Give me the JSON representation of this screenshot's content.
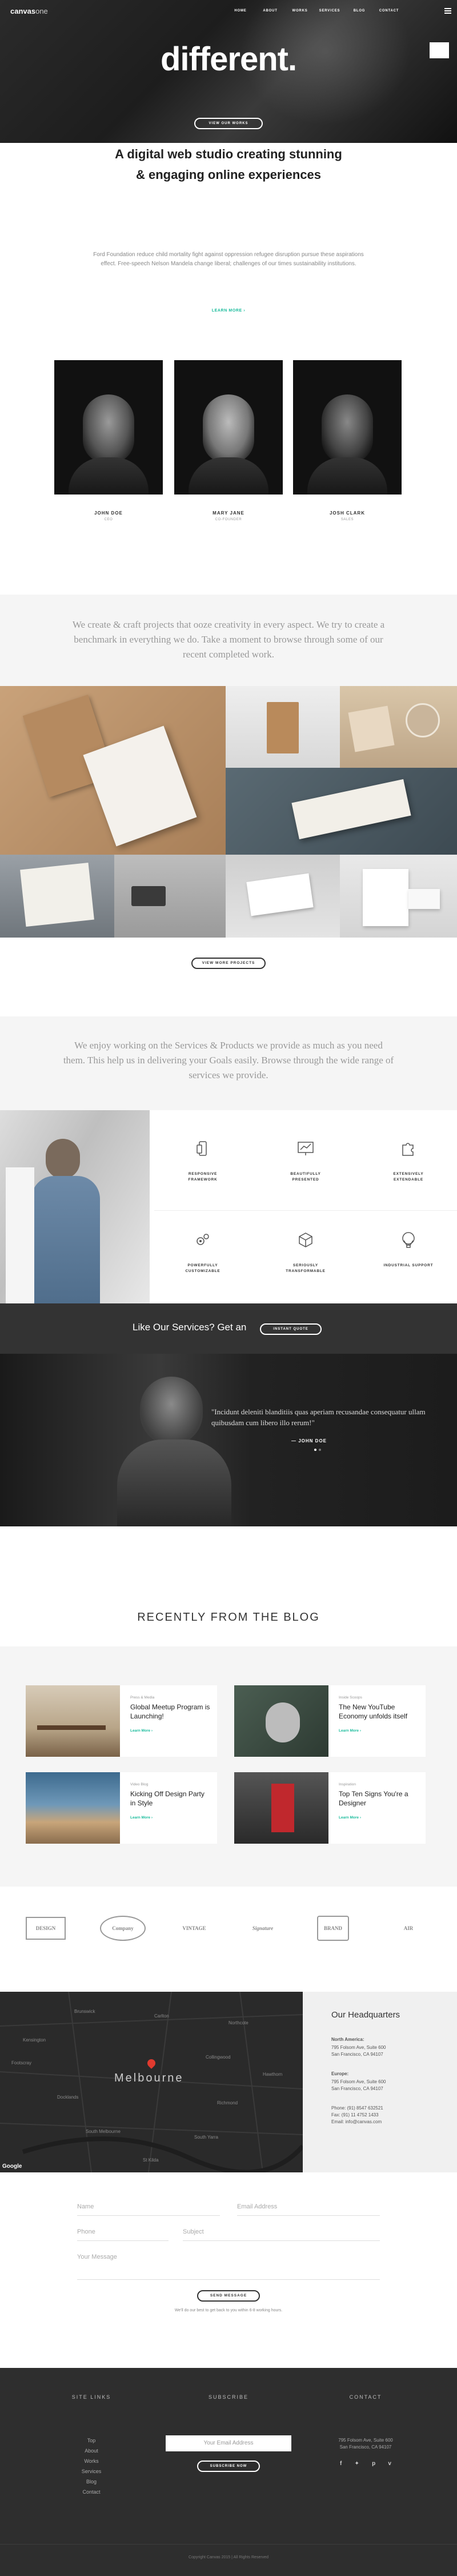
{
  "header": {
    "logo_main": "canvas",
    "logo_accent": "one",
    "nav": [
      "HOME",
      "ABOUT",
      "WORKS",
      "SERVICES",
      "BLOG",
      "CONTACT"
    ],
    "hero_title": "different.",
    "hero_button": "VIEW OUR WORKS"
  },
  "intro": {
    "heading_line1": "A digital web studio creating stunning",
    "heading_line2": "& engaging online experiences",
    "paragraph": "Ford Foundation reduce child mortality fight against oppression refugee disruption pursue these aspirations effect. Free-speech Nelson Mandela change liberal; challenges of our times sustainability institutions.",
    "link": "LEARN MORE ›"
  },
  "team": [
    {
      "name": "JOHN DOE",
      "role": "CEO"
    },
    {
      "name": "MARY JANE",
      "role": "CO-FOUNDER"
    },
    {
      "name": "JOSH CLARK",
      "role": "SALES"
    }
  ],
  "works": {
    "intro": "We create & craft projects that ooze creativity in every aspect. We try to create a benchmark in everything we do. Take a moment to browse through some of our recent completed work.",
    "button": "VIEW MORE PROJECTS"
  },
  "services": {
    "intro": "We enjoy working on the Services & Products we provide as much as you need them. This help us in delivering your Goals easily. Browse through the wide range of services we provide.",
    "items": [
      {
        "label_1": "RESPONSIVE",
        "label_2": "FRAMEWORK",
        "icon": "mobile-icon"
      },
      {
        "label_1": "BEAUTIFULLY",
        "label_2": "PRESENTED",
        "icon": "chart-monitor-icon"
      },
      {
        "label_1": "EXTENSIVELY",
        "label_2": "EXTENDABLE",
        "icon": "puzzle-icon"
      },
      {
        "label_1": "POWERFULLY",
        "label_2": "CUSTOMIZABLE",
        "icon": "gears-icon"
      },
      {
        "label_1": "SERIOUSLY",
        "label_2": "TRANSFORMABLE",
        "icon": "cube-icon"
      },
      {
        "label_1": "INDUSTRIAL SUPPORT",
        "label_2": "",
        "icon": "balloon-icon"
      }
    ]
  },
  "cta": {
    "text": "Like Our Services? Get an",
    "button": "INSTANT QUOTE"
  },
  "testimonial": {
    "quote": "\"Incidunt deleniti blanditiis quas aperiam recusandae consequatur ullam quibusdam cum libero illo rerum!\"",
    "author": "— JOHN DOE"
  },
  "blog": {
    "heading": "RECENTLY FROM THE BLOG",
    "posts": [
      {
        "category": "Press & Media",
        "title": "Global Meetup Program is Launching!",
        "more": "Learn More ›"
      },
      {
        "category": "Inside Scoops",
        "title": "The New YouTube Economy unfolds itself",
        "more": "Learn More ›"
      },
      {
        "category": "Video Blog",
        "title": "Kicking Off Design Party in Style",
        "more": "Learn More ›"
      },
      {
        "category": "Inspiration",
        "title": "Top Ten Signs You're a Designer",
        "more": "Learn More ›"
      }
    ]
  },
  "clients": [
    "DESIGN",
    "Company",
    "VINTAGE",
    "Signature",
    "BRAND",
    "AIR"
  ],
  "map": {
    "city": "Melbourne",
    "google": "Google",
    "areas": [
      "Brunswick",
      "Carlton",
      "Northcote",
      "Collingwood",
      "Richmond",
      "South Yarra",
      "St Kilda",
      "South Melbourne",
      "Docklands",
      "Footscray",
      "Kensington",
      "Hawthorn"
    ]
  },
  "headquarters": {
    "heading": "Our Headquarters",
    "na_label": "North America:",
    "na_l1": "795 Folsom Ave, Suite 600",
    "na_l2": "San Francisco, CA 94107",
    "eu_label": "Europe:",
    "eu_l1": "795 Folsom Ave, Suite 600",
    "eu_l2": "San Francisco, CA 94107",
    "phone": "Phone: (91) 8547 632521",
    "fax": "Fax: (91) 11 4752 1433",
    "email": "Email: info@canvas.com"
  },
  "form": {
    "name": "Name",
    "email": "Email Address",
    "phone": "Phone",
    "subject": "Subject",
    "message": "Your Message",
    "button": "SEND MESSAGE",
    "note": "We'll do our best to get back to you within 6-8 working hours."
  },
  "footer": {
    "site_links_h": "SITE LINKS",
    "links": [
      "Top",
      "About",
      "Works",
      "Services",
      "Blog",
      "Contact"
    ],
    "subscribe_h": "SUBSCRIBE",
    "subscribe_placeholder": "Your Email Address",
    "subscribe_button": "SUBSCRIBE NOW",
    "contact_h": "CONTACT",
    "contact_l1": "795 Folsom Ave, Suite 600",
    "contact_l2": "San Francisco, CA 94107",
    "copyright": "Copyright Canvas 2015 | All Rights Reserved"
  },
  "colors": {
    "accent": "#1abc9c",
    "dark": "#333333",
    "footer": "#2e2e2e"
  }
}
